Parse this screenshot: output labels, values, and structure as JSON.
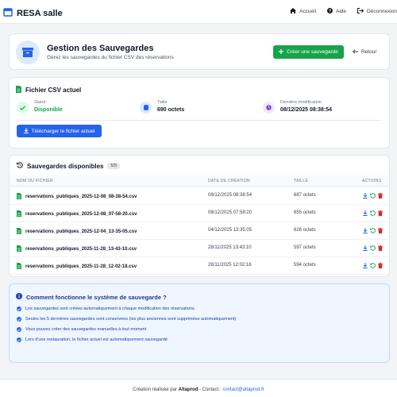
{
  "nav": {
    "brand": "RESA salle",
    "links": [
      "Accueil",
      "Aide",
      "Déconnexion"
    ]
  },
  "header": {
    "title": "Gestion des Sauvegardes",
    "subtitle": "Gérez les sauvegardes du fichier CSV des réservations",
    "create_label": "Créer une sauvegarde",
    "back_label": "Retour"
  },
  "csv": {
    "title": "Fichier CSV actuel",
    "status_label": "Statut",
    "status_value": "Disponible",
    "size_label": "Taille",
    "size_value": "690 octets",
    "modified_label": "Dernière modification",
    "modified_value": "08/12/2025 08:38:54",
    "download_label": "Télécharger le fichier actuel"
  },
  "backups": {
    "title": "Sauvegardes disponibles",
    "count": "5/5",
    "columns": [
      "NOM DU FICHIER",
      "DATE DE CRÉATION",
      "TAILLE",
      "ACTIONS"
    ],
    "rows": [
      {
        "name": "reservations_publiques_2025-12-08_08-38-54.csv",
        "date": "08/12/2025 08:38:54",
        "size": "687 octets"
      },
      {
        "name": "reservations_publiques_2025-12-08_07-58-20.csv",
        "date": "08/12/2025 07:58:20",
        "size": "655 octets"
      },
      {
        "name": "reservations_publiques_2025-12-04_13-35-05.csv",
        "date": "04/12/2025 13:35:05",
        "size": "626 octets"
      },
      {
        "name": "reservations_publiques_2025-11-28_13-43-10.csv",
        "date": "28/11/2025 13:43:10",
        "size": "597 octets"
      },
      {
        "name": "reservations_publiques_2025-11-28_12-02-18.csv",
        "date": "28/11/2025 12:02:18",
        "size": "594 octets"
      }
    ]
  },
  "info": {
    "title": "Comment fonctionne le système de sauvegarde ?",
    "items": [
      "Les sauvegardes sont créées automatiquement à chaque modification des réservations",
      "Seules les 5 dernières sauvegardes sont conservées (les plus anciennes sont supprimées automatiquement)",
      "Vous pouvez créer des sauvegardes manuelles à tout moment",
      "Lors d'une restauration, le fichier actuel est automatiquement sauvegardé"
    ]
  },
  "footer": {
    "prefix": "Création réalisée par",
    "author": "Altaprod",
    "contact_label": "- Contact :",
    "email": "contact@altaprod.fr"
  },
  "colors": {
    "primary": "#2563eb",
    "success": "#16a34a",
    "danger": "#dc2626",
    "accent_purple": "#7c3aed"
  }
}
